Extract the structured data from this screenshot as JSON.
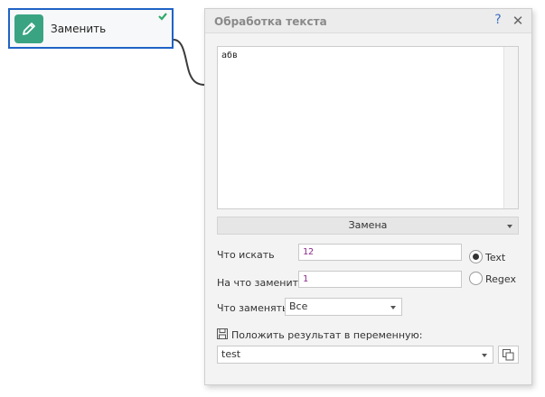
{
  "node": {
    "title": "Заменить",
    "accent": "#3aa482",
    "border": "#1f63c6"
  },
  "dialog": {
    "title": "Обработка текста",
    "help": "?",
    "close": "✕"
  },
  "input_text": "абв",
  "mode": "Замена",
  "find": {
    "label": "Что искать",
    "value": "12"
  },
  "replace": {
    "label": "На что заменить",
    "value": "1"
  },
  "match_type": {
    "options": [
      {
        "label": "Text",
        "checked": true
      },
      {
        "label": "Regex",
        "checked": false
      }
    ]
  },
  "what_replace": {
    "label": "Что заменять",
    "value": "Все"
  },
  "result": {
    "label": "Положить результат в переменную:",
    "value": "test"
  }
}
